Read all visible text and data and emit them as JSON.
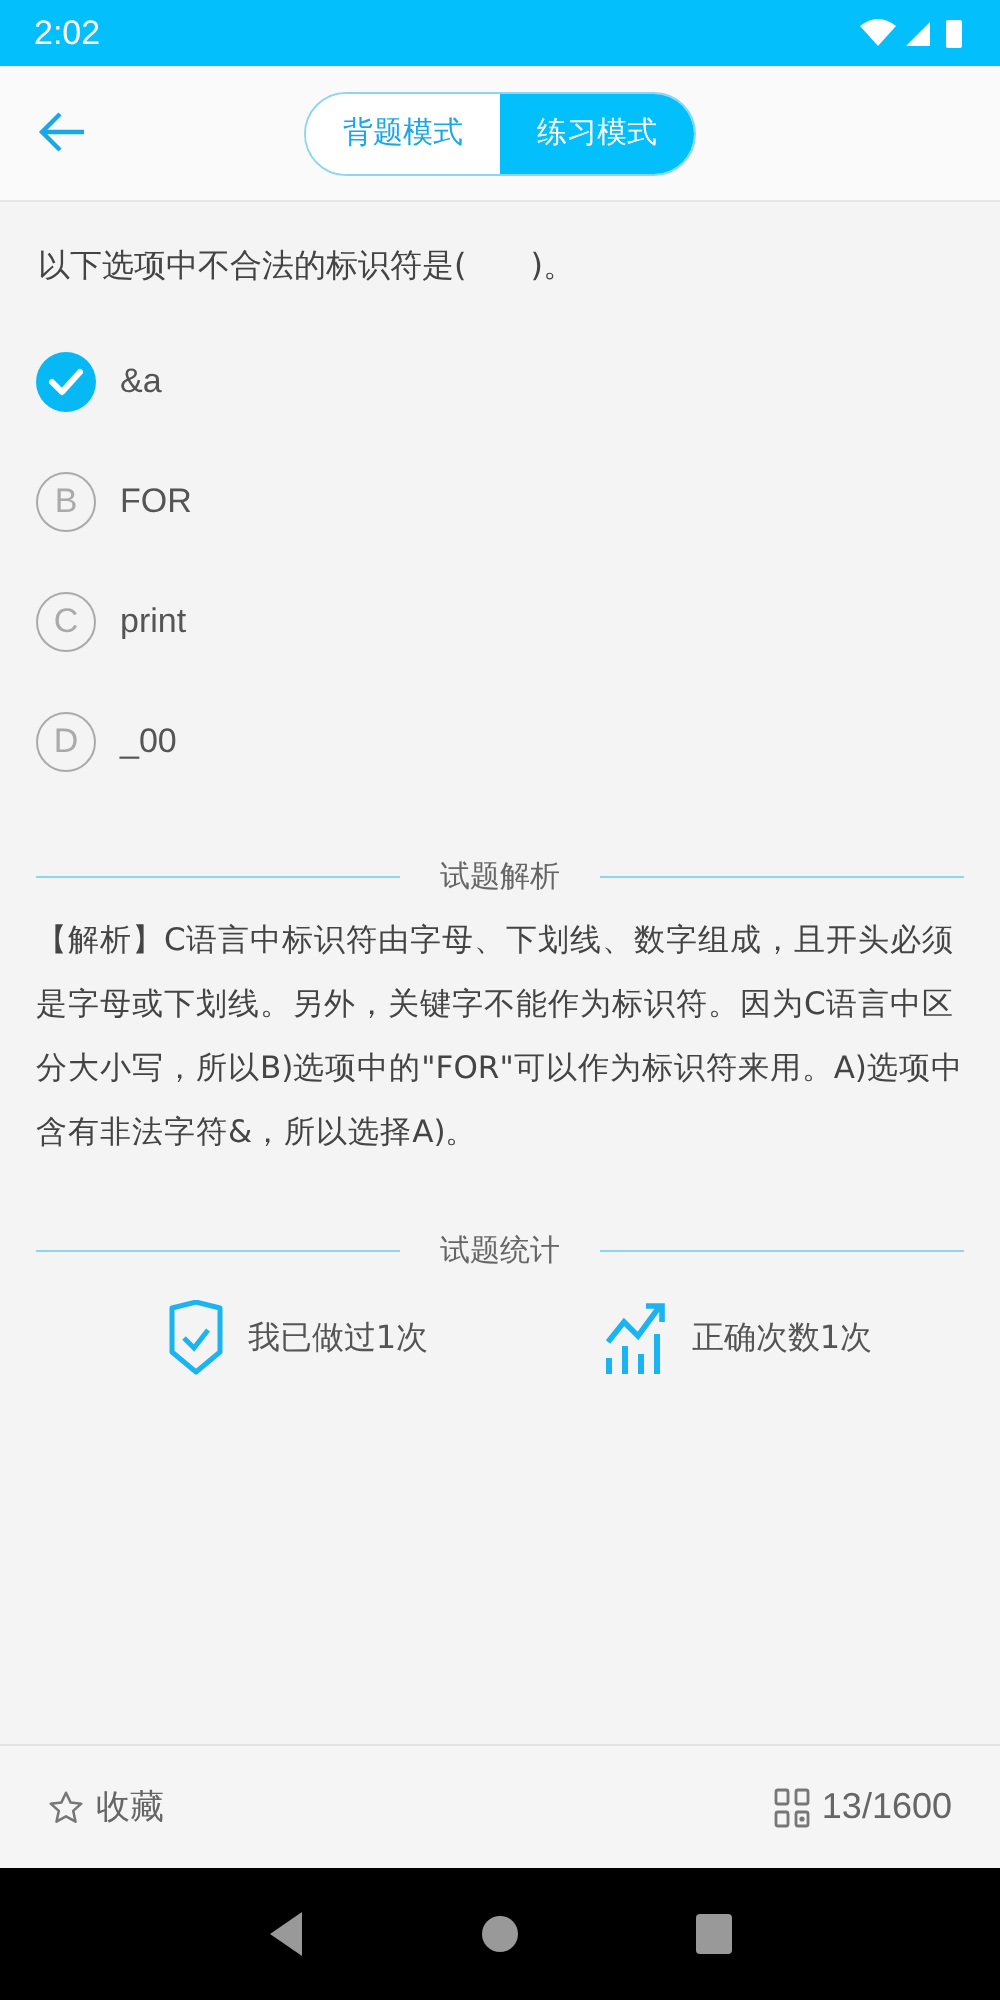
{
  "status_bar": {
    "time": "2:02"
  },
  "header": {
    "tabs": [
      {
        "label": "背题模式",
        "selected": false
      },
      {
        "label": "练习模式",
        "selected": true
      }
    ]
  },
  "question": "以下选项中不合法的标识符是(　　)。",
  "options": [
    {
      "text": "&a",
      "selected": true
    },
    {
      "letter": "B",
      "text": "FOR",
      "selected": false
    },
    {
      "letter": "C",
      "text": "print",
      "selected": false
    },
    {
      "letter": "D",
      "text": "_00",
      "selected": false
    }
  ],
  "analysis": {
    "heading": "试题解析",
    "text": "【解析】C语言中标识符由字母、下划线、数字组成，且开头必须是字母或下划线。另外，关键字不能作为标识符。因为C语言中区分大小写，所以B)选项中的\"FOR\"可以作为标识符来用。A)选项中含有非法字符&，所以选择A)。"
  },
  "stats": {
    "heading": "试题统计",
    "items": [
      {
        "kind": "done",
        "text": "我已做过1次"
      },
      {
        "kind": "correct",
        "text": "正确次数1次"
      }
    ]
  },
  "bottom_bar": {
    "favorite": "收藏",
    "progress": "13/1600"
  }
}
